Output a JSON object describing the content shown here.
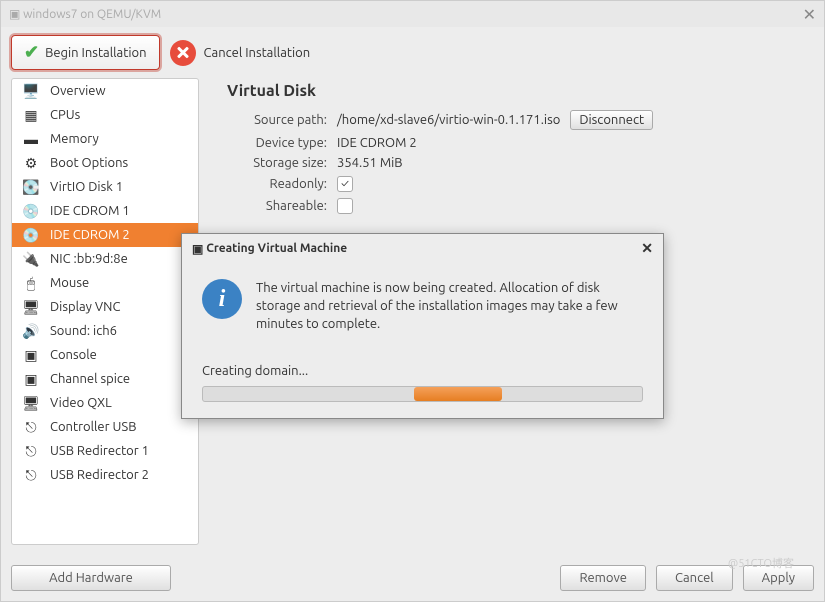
{
  "titlebar": {
    "title": "windows7 on QEMU/KVM"
  },
  "toolbar": {
    "begin_label": "Begin Installation",
    "cancel_label": "Cancel Installation"
  },
  "sidebar": {
    "items": [
      {
        "icon": "🖥️",
        "label": "Overview"
      },
      {
        "icon": "▦",
        "label": "CPUs"
      },
      {
        "icon": "▬",
        "label": "Memory"
      },
      {
        "icon": "⚙",
        "label": "Boot Options"
      },
      {
        "icon": "💽",
        "label": "VirtIO Disk 1"
      },
      {
        "icon": "💿",
        "label": "IDE CDROM 1"
      },
      {
        "icon": "💿",
        "label": "IDE CDROM 2"
      },
      {
        "icon": "🔌",
        "label": "NIC :bb:9d:8e"
      },
      {
        "icon": "🖱",
        "label": "Mouse"
      },
      {
        "icon": "🖥",
        "label": "Display VNC"
      },
      {
        "icon": "🔊",
        "label": "Sound: ich6"
      },
      {
        "icon": "▣",
        "label": "Console"
      },
      {
        "icon": "▣",
        "label": "Channel spice"
      },
      {
        "icon": "🖥",
        "label": "Video QXL"
      },
      {
        "icon": "⎋",
        "label": "Controller USB"
      },
      {
        "icon": "⎋",
        "label": "USB Redirector 1"
      },
      {
        "icon": "⎋",
        "label": "USB Redirector 2"
      }
    ],
    "selected_index": 6
  },
  "main": {
    "title": "Virtual Disk",
    "rows": {
      "source_label": "Source path:",
      "source_value": "/home/xd-slave6/virtio-win-0.1.171.iso",
      "disconnect_label": "Disconnect",
      "device_label": "Device type:",
      "device_value": "IDE CDROM 2",
      "size_label": "Storage size:",
      "size_value": "354.51 MiB",
      "readonly_label": "Readonly:",
      "readonly_checked": "✓",
      "shareable_label": "Shareable:"
    }
  },
  "dialog": {
    "title": "Creating Virtual Machine",
    "message": "The virtual machine is now being created. Allocation of disk storage and retrieval of the installation images may take a few minutes to complete.",
    "progress_label": "Creating domain..."
  },
  "footer": {
    "add_hw": "Add Hardware",
    "remove": "Remove",
    "cancel": "Cancel",
    "apply": "Apply"
  },
  "watermark": "@51CTO博客"
}
